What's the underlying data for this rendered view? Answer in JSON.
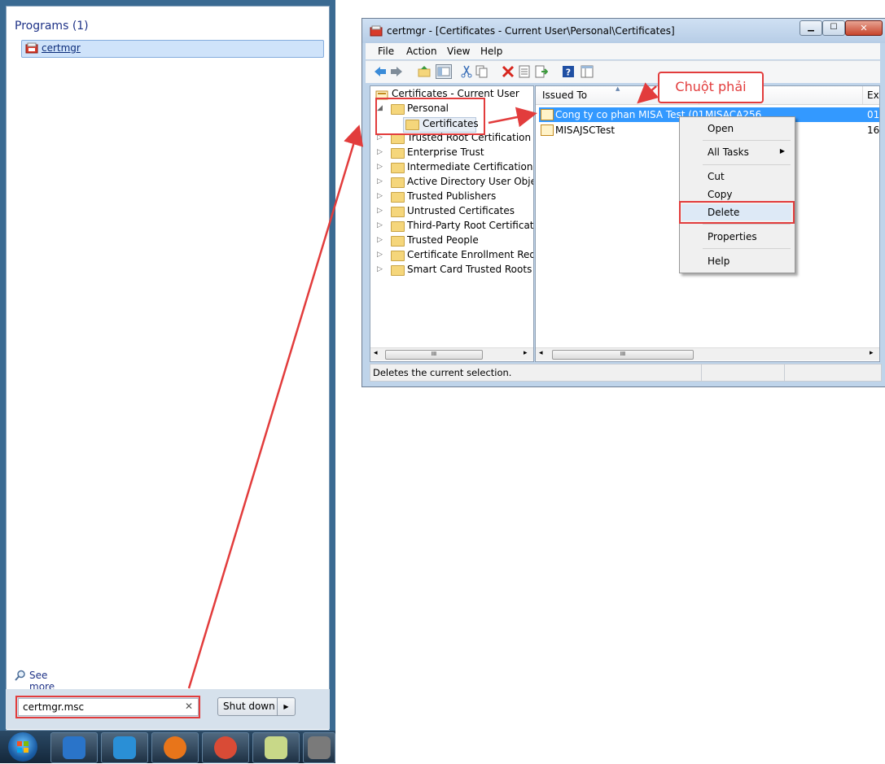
{
  "start_menu": {
    "programs_heading": "Programs (1)",
    "result_label": "certmgr",
    "see_more": "See more results",
    "search_value": "certmgr.msc",
    "clear_glyph": "✕",
    "shutdown_label": "Shut down",
    "shutdown_arrow": "▶"
  },
  "taskbar": {
    "items": [
      {
        "name": "outlook-icon",
        "color": "#2a74c9"
      },
      {
        "name": "remote-desktop-icon",
        "color": "#2a8fd6"
      },
      {
        "name": "firefox-icon",
        "color": "#e8751a"
      },
      {
        "name": "help-lifebuoy-icon",
        "color": "#d94b36"
      },
      {
        "name": "sticky-notes-icon",
        "color": "#c8d888"
      },
      {
        "name": "headset-icon",
        "color": "#7a7a7a"
      }
    ]
  },
  "window": {
    "title": "certmgr - [Certificates - Current User\\Personal\\Certificates]",
    "controls": {
      "minimize": "▁",
      "maximize": "☐",
      "close": "✕"
    },
    "menu": [
      "File",
      "Action",
      "View",
      "Help"
    ],
    "toolbar_icons": [
      "back-icon",
      "forward-icon",
      "up-folder-icon",
      "show-tree-icon",
      "cut-icon",
      "copy-icon",
      "delete-icon",
      "properties-icon",
      "export-icon",
      "help-icon",
      "view-icon"
    ],
    "status": "Deletes the current selection."
  },
  "tree": {
    "root": "Certificates - Current User",
    "items": [
      {
        "label": "Personal",
        "expander": "◢"
      },
      {
        "label": "Certificates",
        "expander": ""
      },
      {
        "label": "Trusted Root Certification Au",
        "expander": "▷"
      },
      {
        "label": "Enterprise Trust",
        "expander": "▷"
      },
      {
        "label": "Intermediate Certification Au",
        "expander": "▷"
      },
      {
        "label": "Active Directory User Object",
        "expander": "▷"
      },
      {
        "label": "Trusted Publishers",
        "expander": "▷"
      },
      {
        "label": "Untrusted Certificates",
        "expander": "▷"
      },
      {
        "label": "Third-Party Root Certification",
        "expander": "▷"
      },
      {
        "label": "Trusted People",
        "expander": "▷"
      },
      {
        "label": "Certificate Enrollment Reques",
        "expander": "▷"
      },
      {
        "label": "Smart Card Trusted Roots",
        "expander": "▷"
      }
    ]
  },
  "list": {
    "columns": [
      "Issued To",
      "Ex"
    ],
    "rows": [
      {
        "issued_to": "Cong ty co phan MISA Test (01",
        "issued_by": "MISACA256",
        "expires": "01"
      },
      {
        "issued_to": "MISAJSCTest",
        "issued_by": "",
        "expires": "16"
      }
    ]
  },
  "scroll": {
    "left": "◂",
    "right": "▸",
    "grip": "III"
  },
  "context_menu": {
    "items": [
      "Open",
      "All Tasks",
      "Cut",
      "Copy",
      "Delete",
      "Properties",
      "Help"
    ],
    "submenu_arrow": "▶"
  },
  "annotation": {
    "callout": "Chuột phải",
    "color": "#e23c3c"
  }
}
